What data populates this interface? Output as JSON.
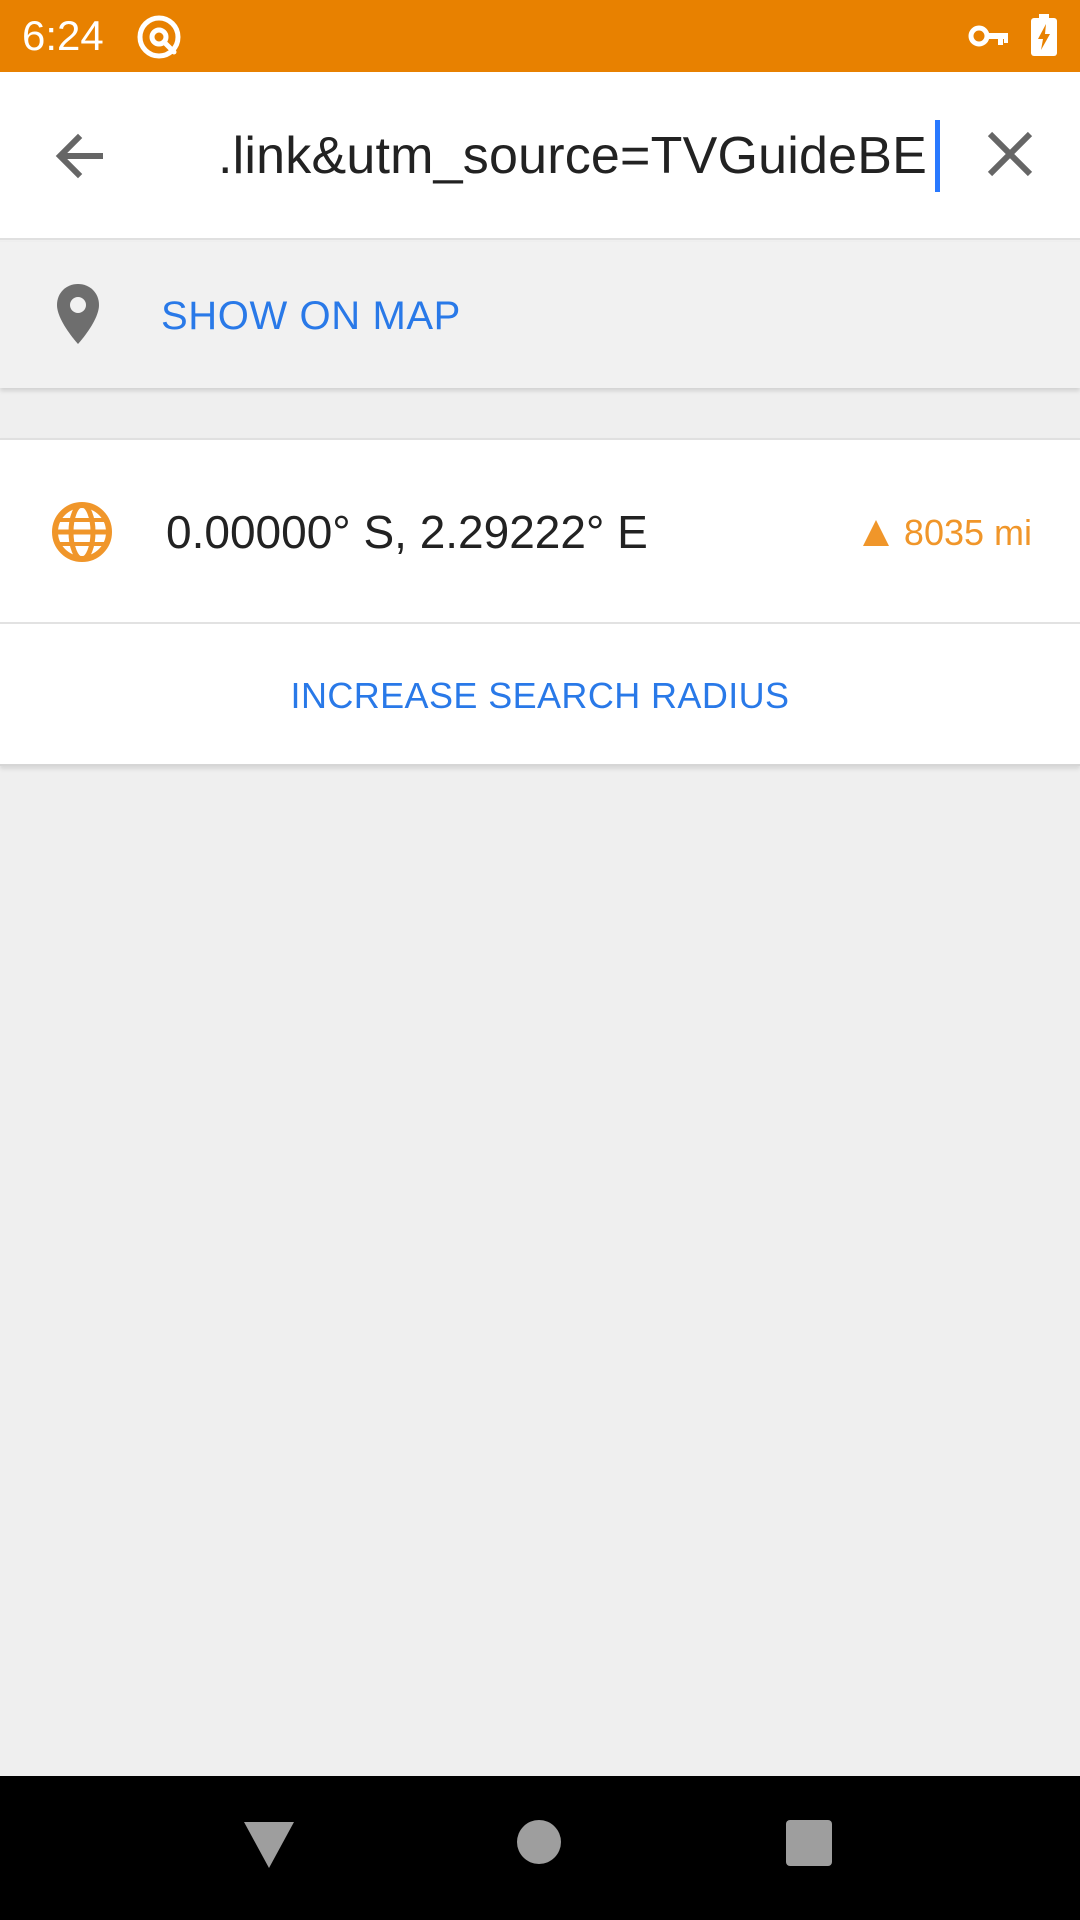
{
  "status_bar": {
    "time": "6:24",
    "icons": [
      "app-notification-icon",
      "vpn-key-icon",
      "battery-charging-icon"
    ],
    "background_color": "#e88100"
  },
  "search": {
    "value": ".link&utm_source=TVGuideBE",
    "icons": [
      "back-arrow-icon",
      "close-icon"
    ]
  },
  "show_on_map": {
    "label": "SHOW ON MAP",
    "icon": "map-pin-icon"
  },
  "result": {
    "coordinates": "0.00000° S, 2.29222° E",
    "distance": "8035 mi",
    "icon": "globe-icon",
    "direction_icon": "direction-arrow-icon",
    "accent_color": "#f0962a"
  },
  "actions": {
    "increase_radius_label": "INCREASE SEARCH RADIUS"
  },
  "colors": {
    "link": "#2979e8",
    "caret": "#2979ff"
  },
  "nav_bar": {
    "buttons": [
      "nav-back-icon",
      "nav-home-icon",
      "nav-recents-icon"
    ]
  }
}
